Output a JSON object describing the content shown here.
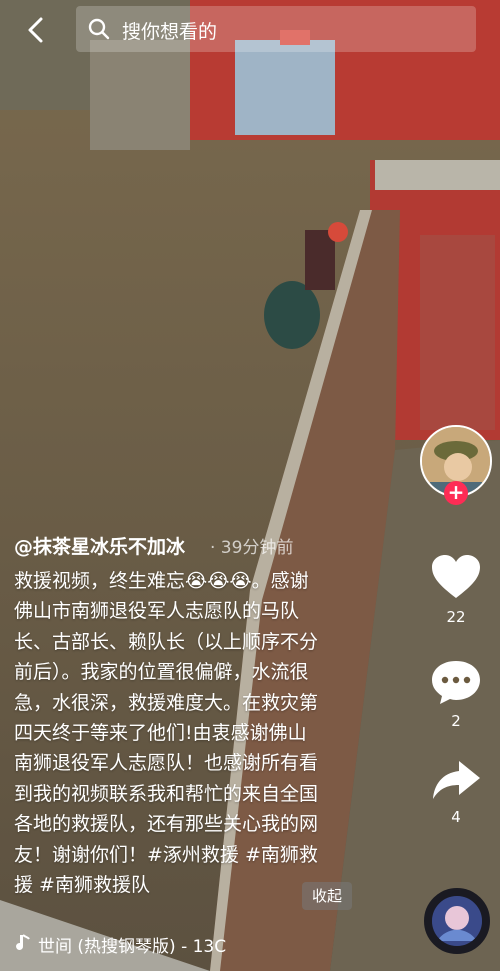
{
  "search": {
    "placeholder": "搜你想看的"
  },
  "author": {
    "name": "@抹茶星冰乐不加冰",
    "time": "· 39分钟前"
  },
  "caption": {
    "text": "救援视频，终生难忘😭😭😭。感谢\n佛山市南狮退役军人志愿队的马队\n长、古部长、赖队长（以上顺序不分\n前后）。我家的位置很偏僻，水流很\n急，水很深，救援难度大。在救灾第\n四天终于等来了他们!由衷感谢佛山\n南狮退役军人志愿队！也感谢所有看\n到我的视频联系我和帮忙的来自全国\n各地的救援队，还有那些关心我的网\n友！谢谢你们！#涿州救援 #南狮救\n援 #南狮救援队"
  },
  "collapse_label": "收起",
  "actions": {
    "likes": "22",
    "comments": "2",
    "shares": "4"
  },
  "follow_label": "+",
  "music": {
    "title": "世间 (热搜钢琴版) - 13C"
  },
  "icons": {
    "back": "back-arrow-icon",
    "search": "search-icon",
    "like": "heart-icon",
    "comment": "comment-icon",
    "share": "share-icon",
    "music": "music-note-icon"
  }
}
